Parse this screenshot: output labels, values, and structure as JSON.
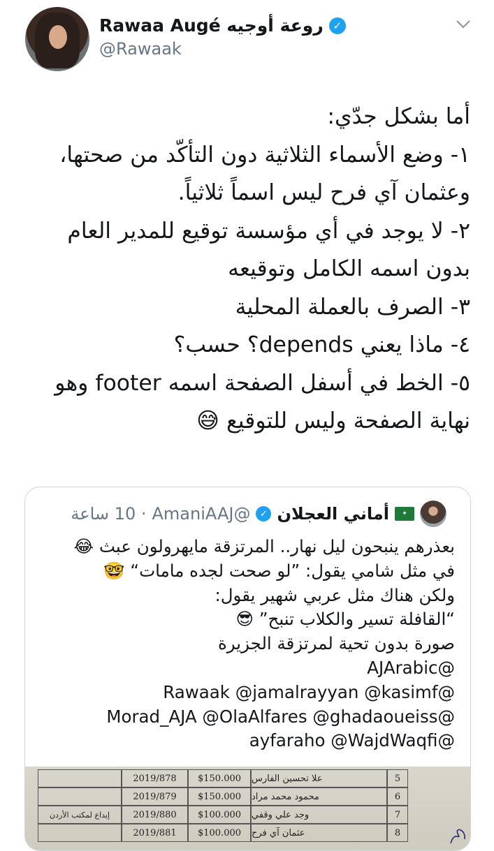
{
  "author": {
    "display_name": "Rawaa Augé روعة أوجيه",
    "handle": "@Rawaak",
    "verified_icon": "verified-badge-icon"
  },
  "tweet": {
    "lines": [
      "أما بشكل جدّي:",
      "١- وضع الأسماء الثلاثية دون التأكّد من صحتها،",
      "وعثمان آي فرح ليس اسماً ثلاثياً.",
      "٢- لا يوجد في أي مؤسسة توقيع للمدير العام",
      "بدون اسمه الكامل وتوقيعه",
      "٣- الصرف بالعملة المحلية",
      "٤- ماذا يعني depends؟ حسب؟",
      "٥- الخط في أسفل الصفحة اسمه footer وهو",
      "نهاية الصفحة وليس للتوقيع 😅"
    ]
  },
  "quote": {
    "display_name": "أماني العجلان",
    "flag": "🇸🇦",
    "handle": "@AmaniAAJ",
    "time": "· 10 ساعة",
    "lines": [
      "بعذرهم ينبحون ليل نهار.. المرتزقة مايهرولون عبث 😂",
      "في مثل شامي يقول: ”لو صحت لجده مامات“ 🤓",
      "ولكن هناك مثل عربي شهير يقول:",
      "“القافلة تسير والكلاب تنبح” 😎",
      "صورة بدون تحية لمرتزقة الجزيرة",
      "@AJArabic",
      "@Rawaak @jamalrayyan @kasimf",
      "@Morad_AJA @OlaAlfares @ghadaoueiss",
      "@ayfaraho @WajdWaqfi"
    ],
    "document_rows": [
      {
        "num": "5",
        "name": "علا تحسين الفارس",
        "amount": "$150.000",
        "ref": "2019/878",
        "note": ""
      },
      {
        "num": "6",
        "name": "محمود محمد مراد",
        "amount": "$150.000",
        "ref": "2019/879",
        "note": ""
      },
      {
        "num": "7",
        "name": "وجد علي وقفي",
        "amount": "$100.000",
        "ref": "2019/880",
        "note": "إيداع لمكتب الأردن"
      },
      {
        "num": "8",
        "name": "عثمان آي فرح",
        "amount": "$100.000",
        "ref": "2019/881",
        "note": ""
      }
    ]
  },
  "colors": {
    "accent": "#1da1f2",
    "muted_text": "#657786",
    "border": "#ccd6dd"
  }
}
